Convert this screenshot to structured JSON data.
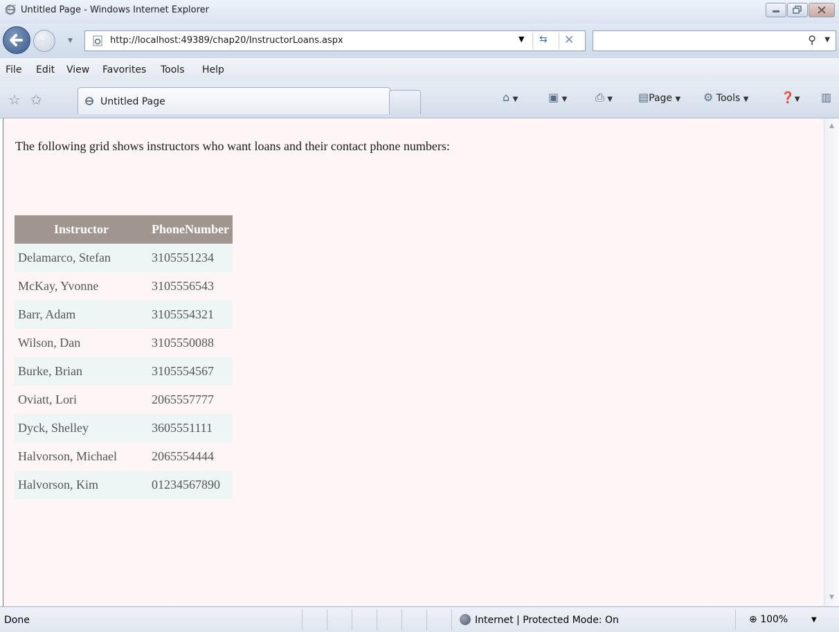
{
  "window": {
    "title": "Untitled Page - Windows Internet Explorer"
  },
  "address_bar": {
    "url": "http://localhost:49389/chap20/InstructorLoans.aspx"
  },
  "menu": {
    "items": [
      "File",
      "Edit",
      "View",
      "Favorites",
      "Tools",
      "Help"
    ]
  },
  "tab": {
    "label": "Untitled Page"
  },
  "command_bar": {
    "page_label": "Page",
    "tools_label": "Tools"
  },
  "page": {
    "intro": "The following grid shows instructors who want loans and their contact phone numbers:",
    "grid": {
      "headers": [
        "Instructor",
        "PhoneNumber"
      ],
      "rows": [
        [
          "Delamarco, Stefan",
          "3105551234"
        ],
        [
          "McKay, Yvonne",
          "3105556543"
        ],
        [
          "Barr, Adam",
          "3105554321"
        ],
        [
          "Wilson, Dan",
          "3105550088"
        ],
        [
          "Burke, Brian",
          "3105554567"
        ],
        [
          "Oviatt, Lori",
          "2065557777"
        ],
        [
          "Dyck, Shelley",
          "3605551111"
        ],
        [
          "Halvorson, Michael",
          "2065554444"
        ],
        [
          "Halvorson, Kim",
          "01234567890"
        ]
      ]
    }
  },
  "status_bar": {
    "status": "Done",
    "zone": "Internet | Protected Mode: On",
    "zoom": "100%"
  }
}
